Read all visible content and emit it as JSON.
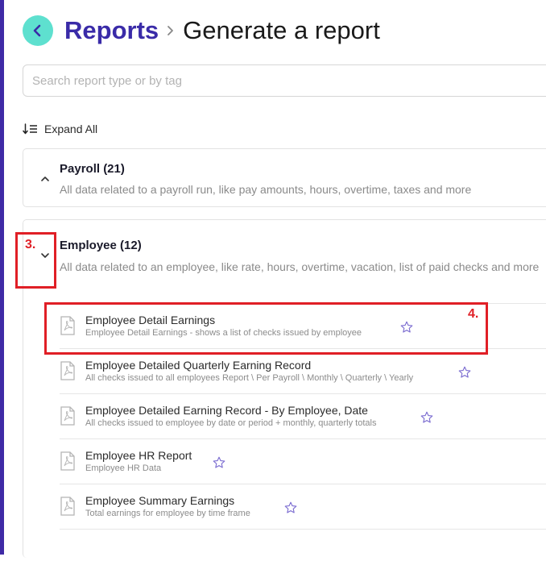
{
  "breadcrumb": {
    "parent": "Reports",
    "current": "Generate a report"
  },
  "search": {
    "placeholder": "Search report type or by tag",
    "value": ""
  },
  "expand_all_label": "Expand All",
  "categories": [
    {
      "title": "Payroll (21)",
      "description": "All data related to a payroll run, like pay amounts, hours, overtime, taxes and more",
      "expanded": false
    },
    {
      "title": "Employee (12)",
      "description": "All data related to an employee, like rate, hours, overtime, vacation, list of paid checks and more",
      "expanded": true,
      "reports": [
        {
          "title": "Employee Detail Earnings",
          "description": "Employee Detail Earnings - shows a list of checks issued by employee",
          "icon": "pdf-file-icon"
        },
        {
          "title": "Employee Detailed Quarterly Earning Record",
          "description": "All checks issued to all employees Report \\ Per Payroll \\ Monthly \\ Quarterly \\ Yearly",
          "icon": "pdf-file-icon"
        },
        {
          "title": "Employee Detailed Earning Record - By Employee, Date",
          "description": "All checks issued to employee by date or period + monthly, quarterly totals",
          "icon": "pdf-file-icon"
        },
        {
          "title": "Employee HR Report",
          "description": "Employee HR Data",
          "icon": "pdf-file-icon"
        },
        {
          "title": "Employee Summary Earnings",
          "description": "Total earnings for employee by time frame",
          "icon": "pdf-file-icon"
        }
      ]
    }
  ],
  "annotations": [
    "3.",
    "4."
  ],
  "colors": {
    "accent": "#3a2ba8",
    "back_button": "#5ee0cf",
    "annotation": "#e01f26",
    "star": "#7a6bd0"
  }
}
